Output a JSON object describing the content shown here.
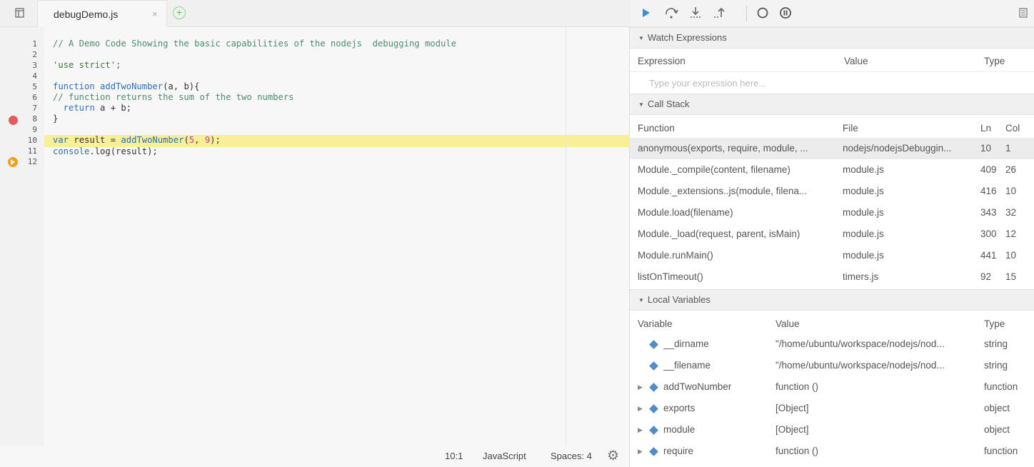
{
  "editor": {
    "tab_title": "debugDemo.js",
    "tab_close": "×",
    "add_tab": "+",
    "lines": [
      {
        "no": "1"
      },
      {
        "no": "2"
      },
      {
        "no": "3"
      },
      {
        "no": "4"
      },
      {
        "no": "5"
      },
      {
        "no": "6"
      },
      {
        "no": "7"
      },
      {
        "no": "8"
      },
      {
        "no": "9"
      },
      {
        "no": "10"
      },
      {
        "no": "11"
      },
      {
        "no": "12"
      }
    ],
    "code": {
      "l1": "// A Demo Code Showing the basic capabilities of the nodejs  debugging module",
      "l3": "'use strict';",
      "l5_kw": "function",
      "l5_name": " addTwoNumber",
      "l5_rest": "(a, b){",
      "l6": "// function returns the sum of the two numbers",
      "l7_kw": "  return",
      "l7_rest": " a + b;",
      "l8": "}",
      "l10_kw": "var",
      "l10_a": " result = ",
      "l10_fn": "addTwoNumber",
      "l10_b": "(",
      "l10_n1": "5",
      "l10_c": ", ",
      "l10_n2": "9",
      "l10_d": ");",
      "l11_obj": "console",
      "l11_rest": ".log(result);"
    },
    "breakpoint_line": "7",
    "current_line": "10",
    "status": {
      "position": "10:1",
      "mode": "JavaScript",
      "spaces": "Spaces: 4"
    }
  },
  "debugger": {
    "toolbar": {
      "icons": [
        "resume-icon",
        "step-over-icon",
        "step-into-icon",
        "step-out-icon",
        "deactivate-breakpoints-icon",
        "pause-on-exceptions-icon",
        "panel-toggle-icon"
      ]
    },
    "watch": {
      "title": "Watch Expressions",
      "col_expression": "Expression",
      "col_value": "Value",
      "col_type": "Type",
      "placeholder": "Type your expression here..."
    },
    "callstack": {
      "title": "Call Stack",
      "col_function": "Function",
      "col_file": "File",
      "col_ln": "Ln",
      "col_col": "Col",
      "rows": [
        {
          "fn": "anonymous(exports, require, module, ...",
          "file": "nodejs/nodejsDebuggin...",
          "ln": "10",
          "col": "1"
        },
        {
          "fn": "Module._compile(content, filename)",
          "file": "module.js",
          "ln": "409",
          "col": "26"
        },
        {
          "fn": "Module._extensions..js(module, filena...",
          "file": "module.js",
          "ln": "416",
          "col": "10"
        },
        {
          "fn": "Module.load(filename)",
          "file": "module.js",
          "ln": "343",
          "col": "32"
        },
        {
          "fn": "Module._load(request, parent, isMain)",
          "file": "module.js",
          "ln": "300",
          "col": "12"
        },
        {
          "fn": "Module.runMain()",
          "file": "module.js",
          "ln": "441",
          "col": "10"
        },
        {
          "fn": "listOnTimeout()",
          "file": "timers.js",
          "ln": "92",
          "col": "15"
        }
      ]
    },
    "locals": {
      "title": "Local Variables",
      "col_variable": "Variable",
      "col_value": "Value",
      "col_type": "Type",
      "rows": [
        {
          "name": "__dirname",
          "value": "\"/home/ubuntu/workspace/nodejs/nod...",
          "type": "string",
          "expandable": false
        },
        {
          "name": "__filename",
          "value": "\"/home/ubuntu/workspace/nodejs/nod...",
          "type": "string",
          "expandable": false
        },
        {
          "name": "addTwoNumber",
          "value": "function ()",
          "type": "function",
          "expandable": true
        },
        {
          "name": "exports",
          "value": "[Object]",
          "type": "object",
          "expandable": true
        },
        {
          "name": "module",
          "value": "[Object]",
          "type": "object",
          "expandable": true
        },
        {
          "name": "require",
          "value": "function ()",
          "type": "function",
          "expandable": true
        }
      ]
    },
    "colors": {
      "accent": "#3e8ddd",
      "breakpoint": "#e35b5b",
      "current_line": "#f8ef99"
    }
  }
}
